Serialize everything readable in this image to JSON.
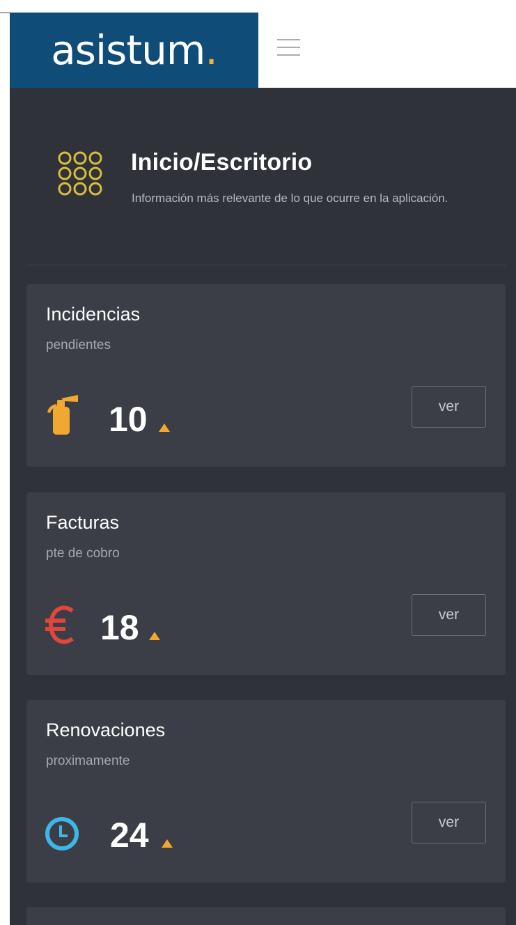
{
  "header": {
    "brand": "asistum",
    "brand_dot": ".",
    "menu_icon": "hamburger-icon"
  },
  "page": {
    "icon": "grid-dots-icon",
    "title": "Inicio/Escritorio",
    "subtitle": "Información más relevante de lo que ocurre en la aplicación."
  },
  "cards": [
    {
      "title": "Incidencias",
      "subtitle": "pendientes",
      "value": "10",
      "icon": "fire-extinguisher-icon",
      "icon_color": "#f0a830",
      "button": "ver"
    },
    {
      "title": "Facturas",
      "subtitle": "pte de cobro",
      "value": "18",
      "icon": "euro-icon",
      "icon_color": "#e0463c",
      "button": "ver"
    },
    {
      "title": "Renovaciones",
      "subtitle": "proximamente",
      "value": "24",
      "icon": "clock-icon",
      "icon_color": "#3fb7e6",
      "button": "ver"
    }
  ],
  "colors": {
    "brand_bg": "#0f4c78",
    "accent": "#f1b434",
    "page_bg": "#2f3239",
    "card_bg": "#3b3e46",
    "trend": "#f0a830"
  }
}
